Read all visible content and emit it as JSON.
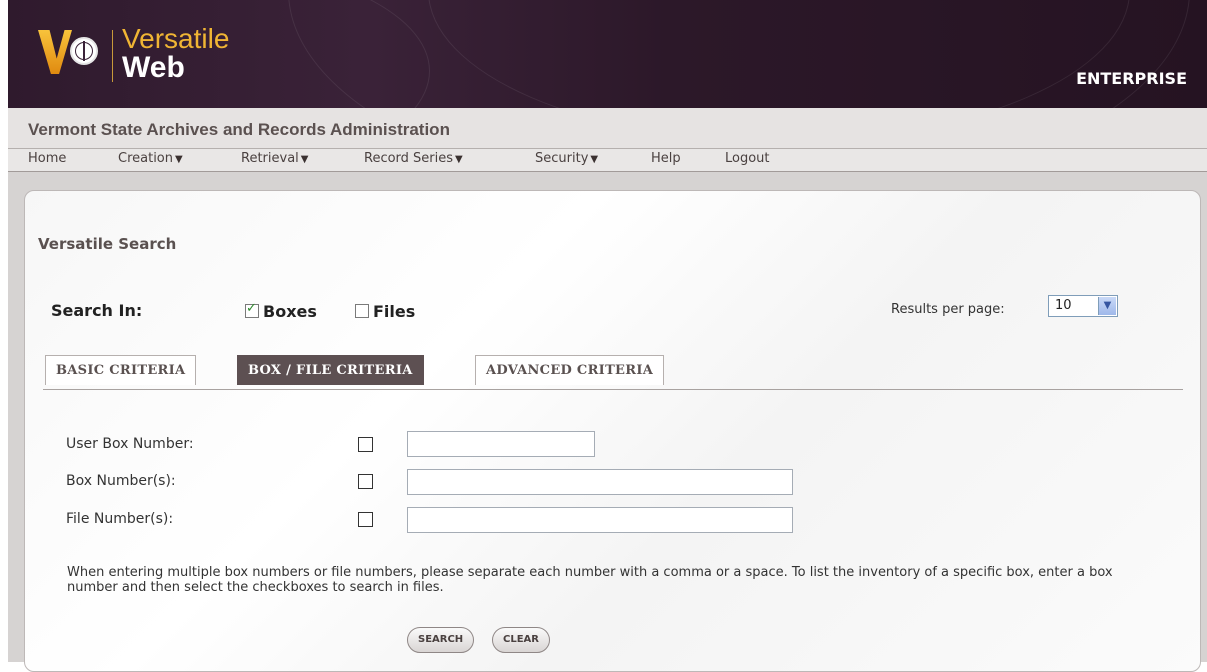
{
  "brand": {
    "name_line1": "Versatile",
    "name_line2": "Web",
    "edition": "ENTERPRISE"
  },
  "org_name": "Vermont State Archives and Records Administration",
  "menu": [
    {
      "label": "Home",
      "has_dropdown": false
    },
    {
      "label": "Creation",
      "has_dropdown": true
    },
    {
      "label": "Retrieval",
      "has_dropdown": true
    },
    {
      "label": "Record Series",
      "has_dropdown": true
    },
    {
      "label": "Security",
      "has_dropdown": true
    },
    {
      "label": "Help",
      "has_dropdown": false
    },
    {
      "label": "Logout",
      "has_dropdown": false
    }
  ],
  "page": {
    "title": "Versatile Search",
    "search_in_label": "Search In:",
    "search_in_options": [
      {
        "label": "Boxes",
        "checked": true
      },
      {
        "label": "Files",
        "checked": false
      }
    ],
    "results_per_page_label": "Results per page:",
    "results_per_page_value": "10"
  },
  "tabs": [
    {
      "label": "BASIC CRITERIA",
      "active": false
    },
    {
      "label": "BOX / FILE CRITERIA",
      "active": true
    },
    {
      "label": "ADVANCED CRITERIA",
      "active": false
    }
  ],
  "criteria": [
    {
      "label": "User Box Number:",
      "checked": false,
      "value": ""
    },
    {
      "label": "Box Number(s):",
      "checked": false,
      "value": ""
    },
    {
      "label": "File Number(s):",
      "checked": false,
      "value": ""
    }
  ],
  "help_text": "When entering multiple box numbers or file numbers, please separate each number with a comma or a space. To list the inventory of a specific box, enter a box number and then select the checkboxes to search in files.",
  "buttons": {
    "search": "SEARCH",
    "clear": "CLEAR"
  },
  "colors": {
    "banner": "#2f1a2d",
    "brand_accent": "#f0b534",
    "active_tab": "#5d5052",
    "page_bg": "#d6d3d2"
  }
}
